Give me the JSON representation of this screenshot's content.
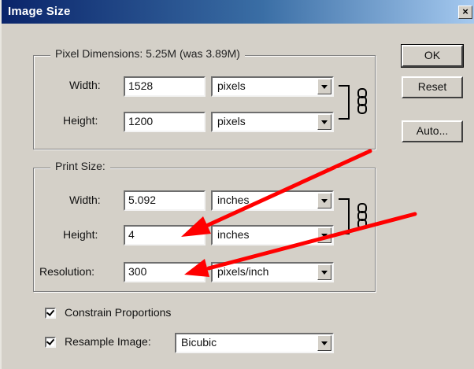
{
  "window": {
    "title": "Image Size",
    "close_glyph": "×"
  },
  "pixel_dimensions": {
    "legend": "Pixel Dimensions:  5.25M (was 3.89M)",
    "width_label": "Width:",
    "width_value": "1528",
    "width_unit": "pixels",
    "height_label": "Height:",
    "height_value": "1200",
    "height_unit": "pixels"
  },
  "print_size": {
    "legend": "Print Size:",
    "width_label": "Width:",
    "width_value": "5.092",
    "width_unit": "inches",
    "height_label": "Height:",
    "height_value": "4",
    "height_unit": "inches",
    "resolution_label": "Resolution:",
    "resolution_value": "300",
    "resolution_unit": "pixels/inch"
  },
  "options": {
    "constrain_label": "Constrain Proportions",
    "constrain_checked": true,
    "resample_label": "Resample Image:",
    "resample_checked": true,
    "resample_method": "Bicubic"
  },
  "buttons": {
    "ok": "OK",
    "reset": "Reset",
    "auto": "Auto..."
  },
  "icons": {
    "link": "chain-link-icon",
    "annotation": "red-arrow"
  },
  "colors": {
    "annotation_arrow": "#ff0000",
    "title_bar": "#0a246a"
  }
}
